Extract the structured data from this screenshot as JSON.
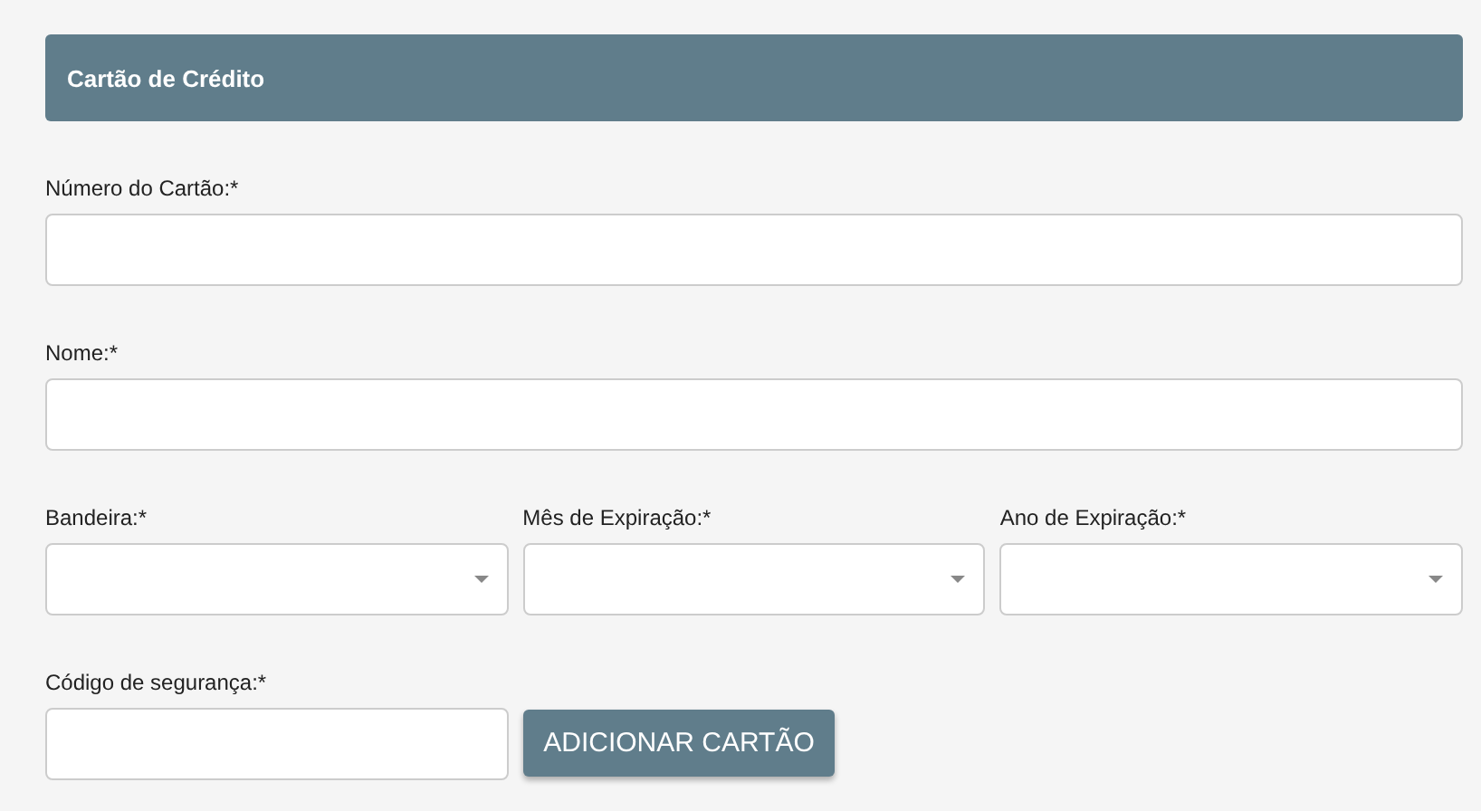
{
  "header": {
    "title": "Cartão de Crédito"
  },
  "rows": [
    {
      "fields": [
        {
          "label": "Número do Cartão:*",
          "kind": "text"
        }
      ]
    },
    {
      "fields": [
        {
          "label": "Nome:*",
          "kind": "text"
        }
      ]
    },
    {
      "fields": [
        {
          "label": "Bandeira:*",
          "kind": "select"
        },
        {
          "label": "Mês de Expiração:*",
          "kind": "select"
        },
        {
          "label": "Ano de Expiração:*",
          "kind": "select"
        }
      ]
    },
    {
      "fields": [
        {
          "label": "Código de segurança:*",
          "kind": "text"
        }
      ],
      "button": {
        "label": "ADICIONAR CARTÃO"
      }
    }
  ]
}
